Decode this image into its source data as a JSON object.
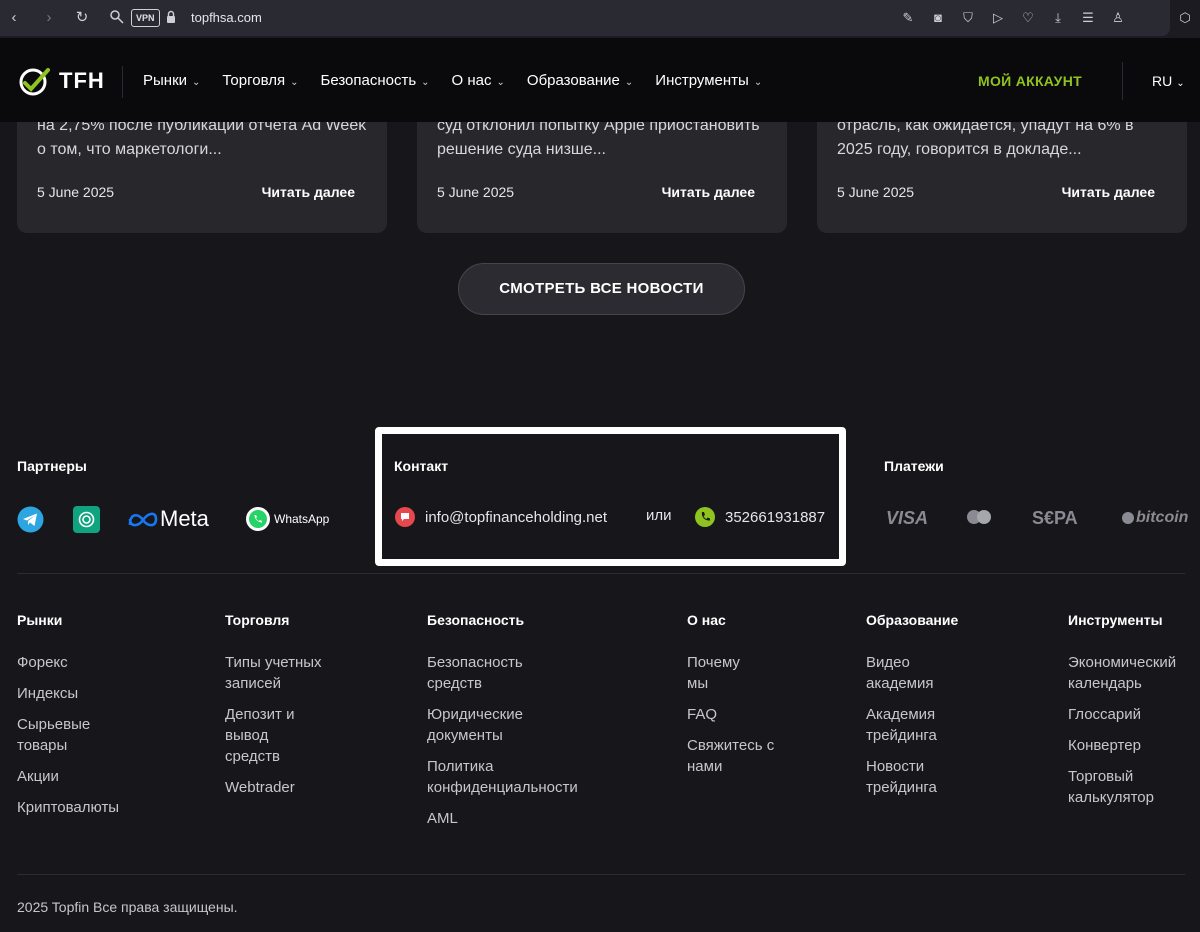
{
  "browser": {
    "url": "topfhsa.com",
    "vpn_label": "VPN"
  },
  "header": {
    "logo_text": "TFH",
    "menu": [
      {
        "label": "Рынки"
      },
      {
        "label": "Торговля"
      },
      {
        "label": "Безопасность"
      },
      {
        "label": "О нас"
      },
      {
        "label": "Образование"
      },
      {
        "label": "Инструменты"
      }
    ],
    "account_label": "МОЙ АККАУНТ",
    "language": "RU",
    "accent_color": "#8fc31f"
  },
  "news": {
    "cards": [
      {
        "excerpt": "на 2,75% после публикации отчета Ad Week о том, что маркетологи...",
        "date": "5 June 2025",
        "more": "Читать далее"
      },
      {
        "excerpt": "суд отклонил попытку Apple приостановить решение суда низше...",
        "date": "5 June 2025",
        "more": "Читать далее"
      },
      {
        "excerpt": "отрасль, как ожидается, упадут на 6% в 2025 году, говорится в докладе...",
        "date": "5 June 2025",
        "more": "Читать далее"
      }
    ],
    "all_news_label": "СМОТРЕТЬ ВСЕ НОВОСТИ"
  },
  "partners": {
    "title": "Партнеры",
    "items": [
      "telegram-icon",
      "chatgpt-icon",
      "Meta",
      "WhatsApp"
    ]
  },
  "contact": {
    "title": "Контакт",
    "email": "info@topfinanceholding.net",
    "or": "или",
    "phone": "352661931887"
  },
  "payments": {
    "title": "Платежи",
    "items": [
      "VISA",
      "mastercard-icon",
      "S€PA",
      "bitcoin"
    ]
  },
  "footer": {
    "columns": [
      {
        "title": "Рынки",
        "links": [
          "Форекс",
          "Индексы",
          "Сырьевые товары",
          "Акции",
          "Криптовалюты"
        ]
      },
      {
        "title": "Торговля",
        "links": [
          "Типы учетных записей",
          "Депозит и вывод средств",
          "Webtrader"
        ]
      },
      {
        "title": "Безопасность",
        "links": [
          "Безопасность средств",
          "Юридические документы",
          "Политика конфиденциальности",
          "AML"
        ]
      },
      {
        "title": "О нас",
        "links": [
          "Почему мы",
          "FAQ",
          "Свяжитесь с нами"
        ]
      },
      {
        "title": "Образование",
        "links": [
          "Видео академия",
          "Академия трейдинга",
          "Новости трейдинга"
        ]
      },
      {
        "title": "Инструменты",
        "links": [
          "Экономический календарь",
          "Глоссарий",
          "Конвертер",
          "Торговый калькулятор"
        ]
      }
    ],
    "copyright": "2025 Topfin Все права защищены."
  }
}
